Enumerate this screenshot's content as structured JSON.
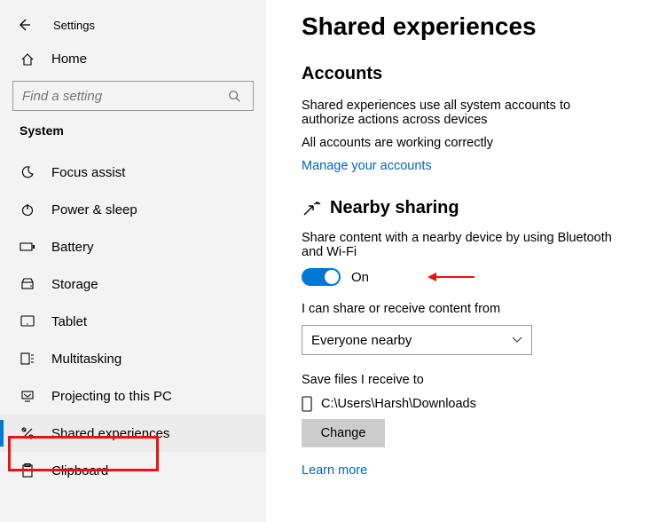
{
  "titlebar": {
    "title": "Settings"
  },
  "home": {
    "label": "Home"
  },
  "search": {
    "placeholder": "Find a setting"
  },
  "category": "System",
  "nav": {
    "items": [
      {
        "label": "Focus assist"
      },
      {
        "label": "Power & sleep"
      },
      {
        "label": "Battery"
      },
      {
        "label": "Storage"
      },
      {
        "label": "Tablet"
      },
      {
        "label": "Multitasking"
      },
      {
        "label": "Projecting to this PC"
      },
      {
        "label": "Shared experiences"
      },
      {
        "label": "Clipboard"
      }
    ]
  },
  "page": {
    "title": "Shared experiences",
    "accounts": {
      "heading": "Accounts",
      "desc": "Shared experiences use all system accounts to authorize actions across devices",
      "status": "All accounts are working correctly",
      "manage_link": "Manage your accounts"
    },
    "nearby": {
      "heading": "Nearby sharing",
      "desc": "Share content with a nearby device by using Bluetooth and Wi-Fi",
      "toggle_state": "On",
      "receive_label": "I can share or receive content from",
      "receive_option": "Everyone nearby",
      "save_label": "Save files I receive to",
      "save_path": "C:\\Users\\Harsh\\Downloads",
      "change_btn": "Change",
      "learn_more": "Learn more"
    }
  }
}
